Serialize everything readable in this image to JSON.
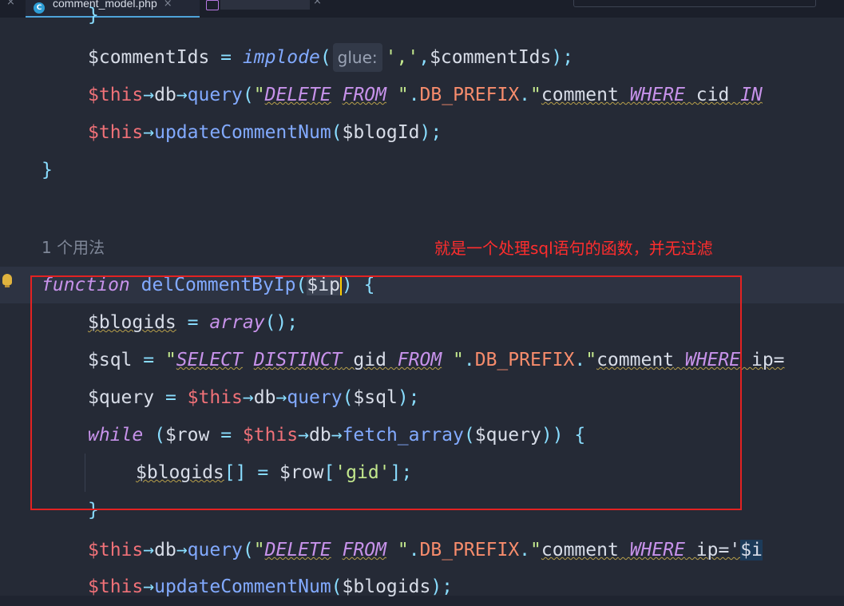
{
  "tabs": [
    {
      "icon": "C",
      "label": "comment_model.php",
      "close": "×"
    },
    {
      "close": "×"
    }
  ],
  "left_close": "×",
  "editor": {
    "usage_hint": "1 个用法",
    "param_hint": "glue:",
    "annotation": "就是一个处理sql语句的函数，并无过滤",
    "lines": {
      "l0": "}",
      "l1a": "$commentIds",
      "l1b": " = ",
      "l1c": "implode",
      "l1d": "(",
      "l1e": "','",
      "l1f": ",",
      "l1g": "$commentIds",
      "l1h": ");",
      "l2a": "$this",
      "l2b": "→",
      "l2c": "db",
      "l2d": "→",
      "l2e": "query",
      "l2f": "(",
      "l2g": "\"",
      "l2h": "DELETE",
      "l2i": " ",
      "l2j": "FROM",
      "l2k": " \"",
      "l2l": ".",
      "l2m": "DB_PREFIX",
      "l2n": ".",
      "l2o": "\"",
      "l2p": "comment",
      "l2q": " ",
      "l2r": "WHERE",
      "l2s": " cid ",
      "l2t": "IN",
      "l3a": "$this",
      "l3b": "→",
      "l3c": "updateCommentNum",
      "l3d": "(",
      "l3e": "$blogId",
      "l3f": ");",
      "l4": "}",
      "l5a": "function",
      "l5b": " ",
      "l5c": "delCommentByIp",
      "l5d": "(",
      "l5e": "$ip",
      "l5f": ") {",
      "l6a": "$blogids",
      "l6b": " = ",
      "l6c": "array",
      "l6d": "();",
      "l7a": "$sql",
      "l7b": " = ",
      "l7c": "\"",
      "l7d": "SELECT",
      "l7e": " ",
      "l7f": "DISTINCT",
      "l7g": " gid ",
      "l7h": "FROM",
      "l7i": " \"",
      "l7j": ".",
      "l7k": "DB_PREFIX",
      "l7l": ".",
      "l7m": "\"",
      "l7n": "comment",
      "l7o": " ",
      "l7p": "WHERE",
      "l7q": " ip=",
      "l8a": "$query",
      "l8b": " = ",
      "l8c": "$this",
      "l8d": "→",
      "l8e": "db",
      "l8f": "→",
      "l8g": "query",
      "l8h": "(",
      "l8i": "$sql",
      "l8j": ");",
      "l9a": "while",
      "l9b": " (",
      "l9c": "$row",
      "l9d": " = ",
      "l9e": "$this",
      "l9f": "→",
      "l9g": "db",
      "l9h": "→",
      "l9i": "fetch_array",
      "l9j": "(",
      "l9k": "$query",
      "l9l": ")) {",
      "l10a": "$blogids",
      "l10b": "[] = ",
      "l10c": "$row",
      "l10d": "[",
      "l10e": "'gid'",
      "l10f": "];",
      "l11": "}",
      "l12a": "$this",
      "l12b": "→",
      "l12c": "db",
      "l12d": "→",
      "l12e": "query",
      "l12f": "(",
      "l12g": "\"",
      "l12h": "DELETE",
      "l12i": " ",
      "l12j": "FROM",
      "l12k": " \"",
      "l12l": ".",
      "l12m": "DB_PREFIX",
      "l12n": ".",
      "l12o": "\"",
      "l12p": "comment",
      "l12q": " ",
      "l12r": "WHERE",
      "l12s": " ip='",
      "l12t": "$i",
      "l13a": "$this",
      "l13b": "→",
      "l13c": "updateCommentNum",
      "l13d": "(",
      "l13e": "$blogids",
      "l13f": ");"
    }
  }
}
